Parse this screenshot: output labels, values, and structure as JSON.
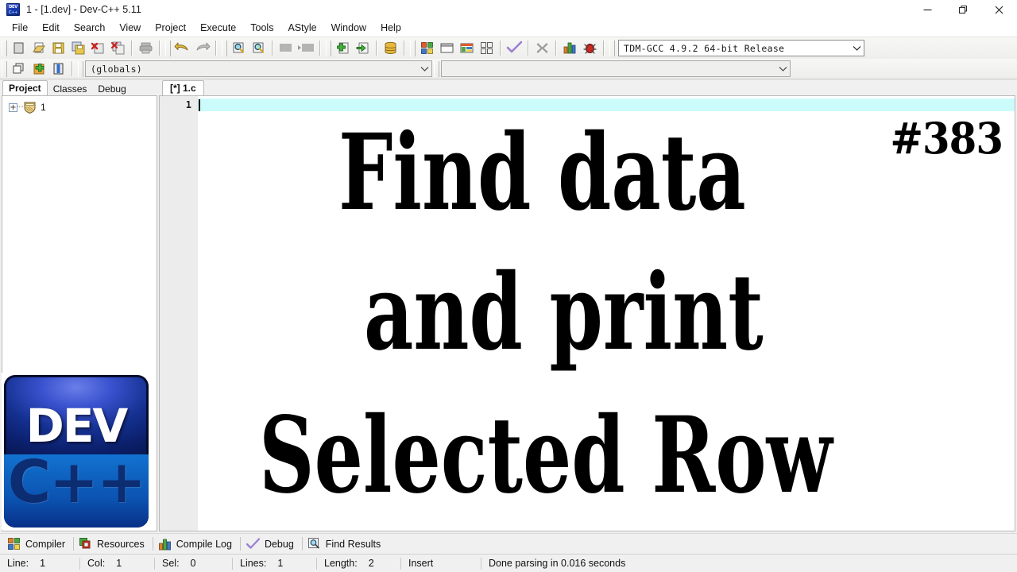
{
  "window": {
    "title": "1 - [1.dev] - Dev-C++ 5.11",
    "app_icon": "devcpp-icon",
    "minimize_label": "─",
    "restore_label": "❐",
    "close_label": "✕"
  },
  "menubar": {
    "items": [
      {
        "label": "File"
      },
      {
        "label": "Edit"
      },
      {
        "label": "Search"
      },
      {
        "label": "View"
      },
      {
        "label": "Project"
      },
      {
        "label": "Execute"
      },
      {
        "label": "Tools"
      },
      {
        "label": "AStyle"
      },
      {
        "label": "Window"
      },
      {
        "label": "Help"
      }
    ]
  },
  "toolbar": {
    "row1": [
      {
        "name": "new-file-button",
        "icon": "new-file-icon"
      },
      {
        "name": "open-file-button",
        "icon": "open-folder-icon"
      },
      {
        "name": "save-button",
        "icon": "save-disk-icon"
      },
      {
        "name": "save-all-button",
        "icon": "save-all-icon"
      },
      {
        "name": "close-file-button",
        "icon": "close-file-icon"
      },
      {
        "name": "close-all-button",
        "icon": "close-all-icon"
      },
      {
        "name": "print-button",
        "icon": "printer-icon"
      },
      {
        "name": "undo-button",
        "icon": "undo-arrow-icon"
      },
      {
        "name": "redo-button",
        "icon": "redo-arrow-icon"
      },
      {
        "name": "find-button",
        "icon": "find-magnifier-icon"
      },
      {
        "name": "replace-button",
        "icon": "replace-magnifier-icon"
      },
      {
        "name": "goto-line-button",
        "icon": "goto-line-icon"
      },
      {
        "name": "goto-next-button",
        "icon": "goto-next-icon"
      },
      {
        "name": "new-project-button",
        "icon": "new-project-icon"
      },
      {
        "name": "add-to-project-button",
        "icon": "add-to-project-icon"
      },
      {
        "name": "project-options-button",
        "icon": "project-options-icon"
      },
      {
        "name": "compile-button",
        "icon": "compile-icon"
      },
      {
        "name": "run-button",
        "icon": "run-window-icon"
      },
      {
        "name": "compile-and-run-button",
        "icon": "compile-run-icon"
      },
      {
        "name": "rebuild-all-button",
        "icon": "rebuild-all-icon"
      },
      {
        "name": "syntax-check-button",
        "icon": "checkmark-icon"
      },
      {
        "name": "stop-execution-button",
        "icon": "stop-x-icon"
      },
      {
        "name": "profile-button",
        "icon": "profile-bars-icon"
      },
      {
        "name": "debug-button",
        "icon": "debug-bug-icon"
      }
    ],
    "compiler_select": {
      "value": "TDM-GCC 4.9.2 64-bit Release",
      "name": "compiler-set-dropdown"
    },
    "row2": [
      {
        "name": "insert-snippet-button",
        "icon": "windows-cascade-icon"
      },
      {
        "name": "toggle-bookmark-button",
        "icon": "add-green-plus-icon"
      },
      {
        "name": "goto-bookmark-button",
        "icon": "book-blue-icon"
      }
    ],
    "scope_select": {
      "value": "(globals)",
      "name": "class-browser-scope-dropdown"
    },
    "member_select": {
      "value": "",
      "name": "class-browser-member-dropdown"
    }
  },
  "left_panel": {
    "tabs": [
      {
        "label": "Project",
        "active": true
      },
      {
        "label": "Classes",
        "active": false
      },
      {
        "label": "Debug",
        "active": false
      }
    ],
    "tree": {
      "expander": "+",
      "node_label": "1",
      "node_icon": "project-shield-icon"
    }
  },
  "editor": {
    "tabs": [
      {
        "label": "[*] 1.c",
        "active": true
      }
    ],
    "gutter_lines": [
      "1"
    ],
    "content": ""
  },
  "bottom_tabs": [
    {
      "label": "Compiler",
      "icon": "compiler-squares-icon",
      "name": "tab-compiler"
    },
    {
      "label": "Resources",
      "icon": "resources-icon",
      "name": "tab-resources"
    },
    {
      "label": "Compile Log",
      "icon": "compile-log-bars-icon",
      "name": "tab-compile-log"
    },
    {
      "label": "Debug",
      "icon": "debug-checkmark-icon",
      "name": "tab-debug"
    },
    {
      "label": "Find Results",
      "icon": "find-results-magnifier-icon",
      "name": "tab-find-results"
    }
  ],
  "statusbar": {
    "line_key": "Line:",
    "line_value": "1",
    "col_key": "Col:",
    "col_value": "1",
    "sel_key": "Sel:",
    "sel_value": "0",
    "lines_key": "Lines:",
    "lines_value": "1",
    "length_key": "Length:",
    "length_value": "2",
    "mode": "Insert",
    "message": "Done parsing in 0.016 seconds"
  },
  "overlay": {
    "issue_number": "#383",
    "line1": "Find data",
    "line2": "and print",
    "line3": "Selected Row",
    "logo": {
      "top_text": "DEV",
      "bottom_text": "C++"
    }
  },
  "colors": {
    "current_line_highlight": "#ccfbfb",
    "gutter_bg": "#ececec",
    "toolbar_bg": "#f0f0ee",
    "panel_bg": "#f0f0f0",
    "editor_bg": "#ffffff",
    "logo_blue": "#1a3bb5"
  }
}
